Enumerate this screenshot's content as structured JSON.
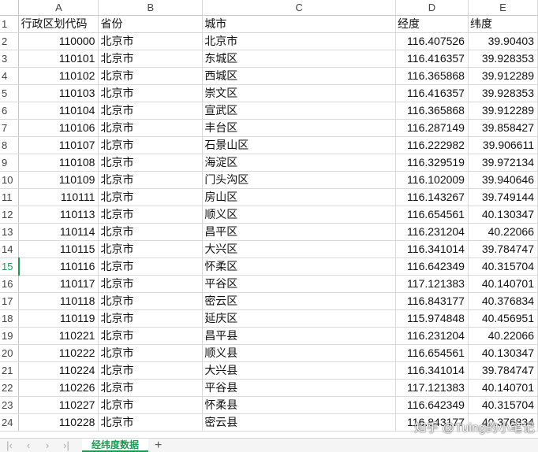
{
  "columns": [
    "A",
    "B",
    "C",
    "D",
    "E"
  ],
  "rows": [
    {
      "n": "1",
      "a": "行政区划代码",
      "b": "省份",
      "c": "城市",
      "d": "经度",
      "e": "纬度",
      "header": true
    },
    {
      "n": "2",
      "a": "110000",
      "b": "北京市",
      "c": "北京市",
      "d": "116.407526",
      "e": "39.90403"
    },
    {
      "n": "3",
      "a": "110101",
      "b": "北京市",
      "c": "东城区",
      "d": "116.416357",
      "e": "39.928353"
    },
    {
      "n": "4",
      "a": "110102",
      "b": "北京市",
      "c": "西城区",
      "d": "116.365868",
      "e": "39.912289"
    },
    {
      "n": "5",
      "a": "110103",
      "b": "北京市",
      "c": "崇文区",
      "d": "116.416357",
      "e": "39.928353"
    },
    {
      "n": "6",
      "a": "110104",
      "b": "北京市",
      "c": "宣武区",
      "d": "116.365868",
      "e": "39.912289"
    },
    {
      "n": "7",
      "a": "110106",
      "b": "北京市",
      "c": "丰台区",
      "d": "116.287149",
      "e": "39.858427"
    },
    {
      "n": "8",
      "a": "110107",
      "b": "北京市",
      "c": "石景山区",
      "d": "116.222982",
      "e": "39.906611"
    },
    {
      "n": "9",
      "a": "110108",
      "b": "北京市",
      "c": "海淀区",
      "d": "116.329519",
      "e": "39.972134"
    },
    {
      "n": "10",
      "a": "110109",
      "b": "北京市",
      "c": "门头沟区",
      "d": "116.102009",
      "e": "39.940646"
    },
    {
      "n": "11",
      "a": "110111",
      "b": "北京市",
      "c": "房山区",
      "d": "116.143267",
      "e": "39.749144"
    },
    {
      "n": "12",
      "a": "110113",
      "b": "北京市",
      "c": "顺义区",
      "d": "116.654561",
      "e": "40.130347"
    },
    {
      "n": "13",
      "a": "110114",
      "b": "北京市",
      "c": "昌平区",
      "d": "116.231204",
      "e": "40.22066"
    },
    {
      "n": "14",
      "a": "110115",
      "b": "北京市",
      "c": "大兴区",
      "d": "116.341014",
      "e": "39.784747"
    },
    {
      "n": "15",
      "a": "110116",
      "b": "北京市",
      "c": "怀柔区",
      "d": "116.642349",
      "e": "40.315704"
    },
    {
      "n": "16",
      "a": "110117",
      "b": "北京市",
      "c": "平谷区",
      "d": "117.121383",
      "e": "40.140701"
    },
    {
      "n": "17",
      "a": "110118",
      "b": "北京市",
      "c": "密云区",
      "d": "116.843177",
      "e": "40.376834"
    },
    {
      "n": "18",
      "a": "110119",
      "b": "北京市",
      "c": "延庆区",
      "d": "115.974848",
      "e": "40.456951"
    },
    {
      "n": "19",
      "a": "110221",
      "b": "北京市",
      "c": "昌平县",
      "d": "116.231204",
      "e": "40.22066"
    },
    {
      "n": "20",
      "a": "110222",
      "b": "北京市",
      "c": "顺义县",
      "d": "116.654561",
      "e": "40.130347"
    },
    {
      "n": "21",
      "a": "110224",
      "b": "北京市",
      "c": "大兴县",
      "d": "116.341014",
      "e": "39.784747"
    },
    {
      "n": "22",
      "a": "110226",
      "b": "北京市",
      "c": "平谷县",
      "d": "117.121383",
      "e": "40.140701"
    },
    {
      "n": "23",
      "a": "110227",
      "b": "北京市",
      "c": "怀柔县",
      "d": "116.642349",
      "e": "40.315704"
    },
    {
      "n": "24",
      "a": "110228",
      "b": "北京市",
      "c": "密云县",
      "d": "116.843177",
      "e": "40.376834"
    }
  ],
  "selected_row": "15",
  "sheet_tab": "经纬度数据",
  "watermark": "知乎 @Tuing的小笔记",
  "accent": "#1e9a53"
}
